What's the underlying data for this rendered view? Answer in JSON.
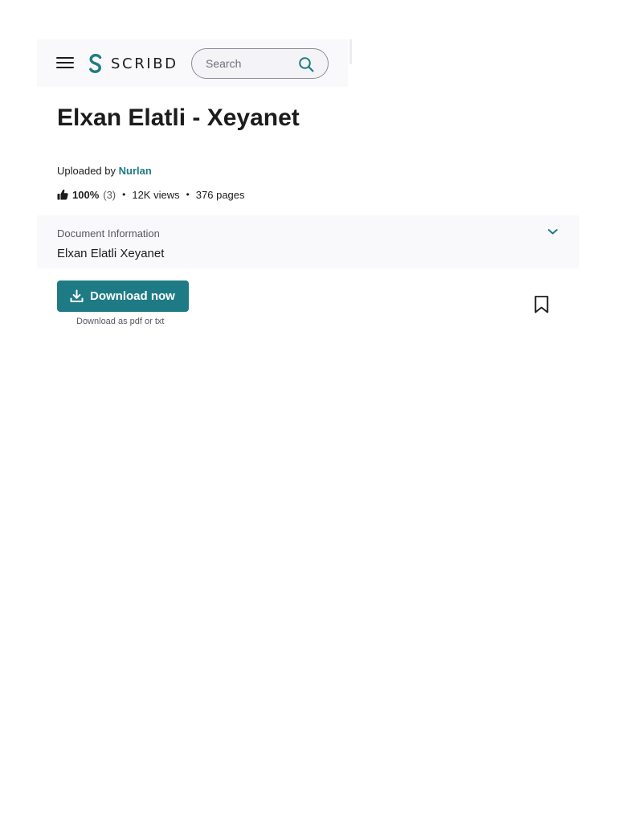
{
  "header": {
    "logo_text": "SCRIBD",
    "search_placeholder": "Search",
    "search_value": ""
  },
  "document": {
    "title": "Elxan Elatli - Xeyanet",
    "uploaded_by_label": "Uploaded by",
    "uploader": "Nurlan",
    "rating_percent": "100%",
    "rating_count": "(3)",
    "views": "12K views",
    "pages": "376 pages"
  },
  "doc_info": {
    "label": "Document Information",
    "value": "Elxan Elatli Xeyanet"
  },
  "actions": {
    "download_label": "Download now",
    "download_sub": "Download as pdf or txt"
  },
  "icons": {
    "menu": "hamburger-menu-icon",
    "logo": "scribd-logo-icon",
    "search": "search-icon",
    "thumb": "thumbs-up-icon",
    "chevron": "chevron-down-icon",
    "download": "download-icon",
    "bookmark": "bookmark-icon"
  },
  "colors": {
    "accent": "#1e7b85",
    "text": "#1c1c1c",
    "muted": "#57575f",
    "panel": "#f9f9fb"
  }
}
